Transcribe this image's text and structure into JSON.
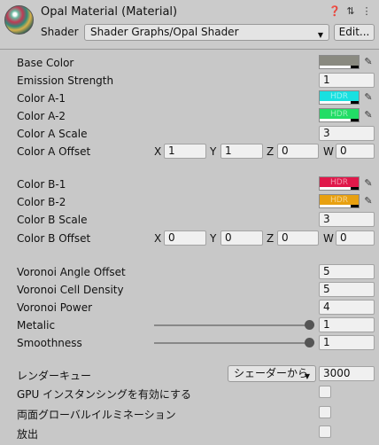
{
  "header": {
    "title": "Opal Material (Material)",
    "shader_label": "Shader",
    "shader_value": "Shader Graphs/Opal Shader",
    "edit_label": "Edit...",
    "icons": [
      "help-icon",
      "preset-icon",
      "menu-icon"
    ]
  },
  "props": {
    "base_color": {
      "label": "Base Color",
      "color": "#8a8a80"
    },
    "emission_strength": {
      "label": "Emission Strength",
      "value": "1"
    },
    "color_a1": {
      "label": "Color A-1",
      "color": "#18e0e0",
      "hdr": "HDR"
    },
    "color_a2": {
      "label": "Color A-2",
      "color": "#22dd66",
      "hdr": "HDR"
    },
    "color_a_scale": {
      "label": "Color A Scale",
      "value": "3"
    },
    "color_a_offset": {
      "label": "Color A Offset",
      "x": "1",
      "y": "1",
      "z": "0",
      "w": "0"
    },
    "color_b1": {
      "label": "Color B-1",
      "color": "#e0184a",
      "hdr": "HDR"
    },
    "color_b2": {
      "label": "Color B-2",
      "color": "#e8a010",
      "hdr": "HDR"
    },
    "color_b_scale": {
      "label": "Color B Scale",
      "value": "3"
    },
    "color_b_offset": {
      "label": "Color B Offset",
      "x": "0",
      "y": "0",
      "z": "0",
      "w": "0"
    },
    "voronoi_angle_offset": {
      "label": "Voronoi Angle Offset",
      "value": "5"
    },
    "voronoi_cell_density": {
      "label": "Voronoi Cell Density",
      "value": "5"
    },
    "voronoi_power": {
      "label": "Voronoi Power",
      "value": "4"
    },
    "metalic": {
      "label": "Metalic",
      "value": "1"
    },
    "smoothness": {
      "label": "Smoothness",
      "value": "1"
    }
  },
  "axes": {
    "x": "X",
    "y": "Y",
    "z": "Z",
    "w": "W"
  },
  "render_queue": {
    "label": "レンダーキュー",
    "dropdown": "シェーダーから",
    "value": "3000"
  },
  "gpu_instancing": {
    "label": "GPU インスタンシングを有効にする",
    "checked": false
  },
  "double_sided_gi": {
    "label": "両面グローバルイルミネーション",
    "checked": false
  },
  "emission": {
    "label": "放出",
    "checked": false
  }
}
